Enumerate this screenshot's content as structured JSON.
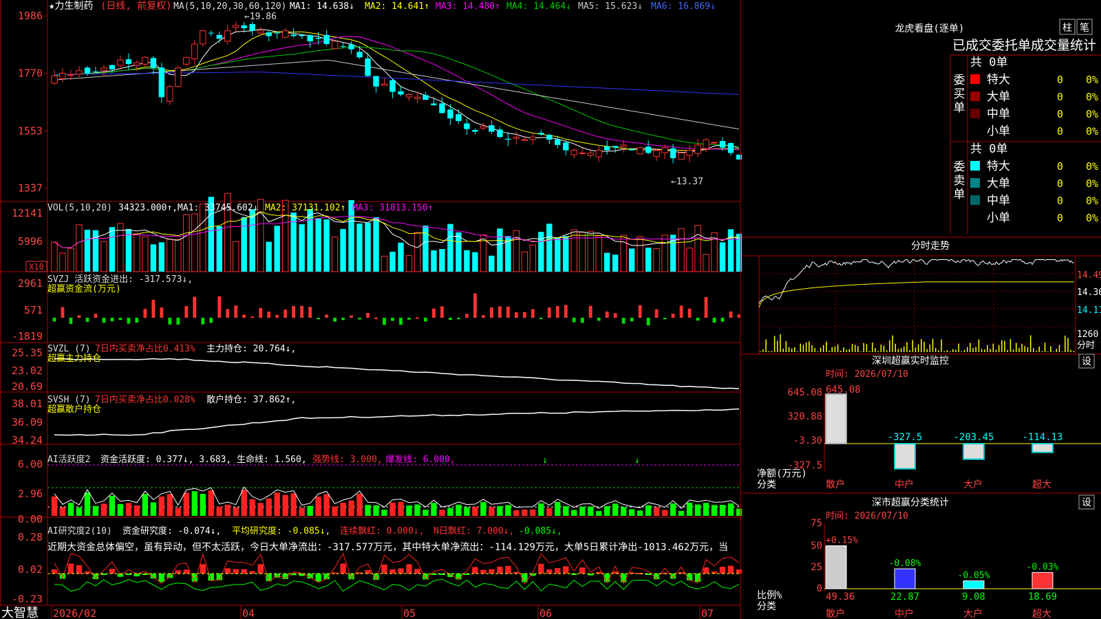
{
  "app": {
    "brand": "大智慧"
  },
  "colors": {
    "up": "#ff3333",
    "down": "#00ffff",
    "buy": "#ff0000",
    "sell": "#00ffff",
    "ma1": "#ffffff",
    "ma2": "#ffff00",
    "ma3": "#ff00ff",
    "ma4": "#00cc00",
    "ma5": "#c8c8c8",
    "ma6": "#3333ff",
    "frame": "#b00000"
  },
  "header": {
    "title": "★力生制药",
    "mode": "(日线, 前复权)",
    "ma_label": "MA(5,10,20,30,60,120)",
    "ma": [
      {
        "name": "MA1",
        "value": "14.638",
        "arrow": "↓"
      },
      {
        "name": "MA2",
        "value": "14.641",
        "arrow": "↑"
      },
      {
        "name": "MA3",
        "value": "14.480",
        "arrow": "↑"
      },
      {
        "name": "MA4",
        "value": "14.464",
        "arrow": "↓"
      },
      {
        "name": "MA5",
        "value": "15.623",
        "arrow": "↓"
      },
      {
        "name": "MA6",
        "value": "16.869",
        "arrow": "↓"
      }
    ]
  },
  "panels": {
    "price": {
      "ticks": [
        "1986",
        "1770",
        "1553",
        "1337"
      ],
      "high_label": "19.86",
      "low_label": "←13.37"
    },
    "vol": {
      "label": "VOL(5,10,20)",
      "value": "34323.000",
      "ma": [
        {
          "name": "MA1",
          "value": "33745.602",
          "arrow": "↓"
        },
        {
          "name": "MA2",
          "value": "37131.102",
          "arrow": "↑"
        },
        {
          "name": "MA3",
          "value": "31813.150",
          "arrow": "↑"
        }
      ],
      "ticks": [
        "12141",
        "5996"
      ],
      "unit": "X10"
    },
    "svzj": {
      "label": "SVZJ  活跃资金进出: -317.573↓,",
      "sub": "超赢资金流(万元)",
      "ticks": [
        "2961",
        "571",
        "-1819"
      ]
    },
    "svzl": {
      "label": "SVZL (7)",
      "l2": "7日内买卖净占比0.413%",
      "l3": "主力持仓: 20.764↓,",
      "sub": "超赢主力持仓",
      "ticks": [
        "25.35",
        "23.02",
        "20.69"
      ]
    },
    "svsh": {
      "label": "SVSH (7)",
      "l2": "7日内买卖净占比0.028%",
      "l3": "散户持仓: 37.862↑,",
      "sub": "超赢散户持仓",
      "ticks": [
        "38.01",
        "36.09",
        "34.24"
      ]
    },
    "ai1": {
      "label": "AI活跃度2",
      "l2": "资金活跃度: 0.377↓, 3.683, 生命线: 1.560,",
      "l3": "强势线: 3.000,",
      "l4": "爆发线: 6.000,",
      "ticks": [
        "6.00",
        "2.96",
        "0.00"
      ]
    },
    "ai2": {
      "label": "AI研究度2(10)",
      "l2": "资金研究度: -0.074↓,",
      "l3": "平均研究度: -0.085↓,",
      "l4": "连续飘红: 0.000↓,",
      "l5": "N日飘红: 7.000↓,",
      "l6": "-0.085↓,",
      "text": "近期大资金总体偏空，虽有异动，但不太活跃，今日大单净流出：-317.577万元，其中特大单净流出：-114.129万元，大单5日累计净出-1013.462万元，当",
      "ticks": [
        "0.28",
        "0.02",
        "-0.23"
      ]
    }
  },
  "xaxis": [
    "2026/02",
    "04",
    "05",
    "06",
    "07"
  ],
  "right": {
    "lhb": {
      "title": "龙虎看盘(逐单)",
      "btn1": "柱",
      "btn2": "笔",
      "subtitle": "已成交委托单成交量统计",
      "buy": {
        "side": "委买单",
        "total": "共 0单",
        "rows": [
          {
            "label": "特大",
            "n": "0",
            "pct": "0%",
            "color": "#ff0000"
          },
          {
            "label": "大单",
            "n": "0",
            "pct": "0%",
            "color": "#990000"
          },
          {
            "label": "中单",
            "n": "0",
            "pct": "0%",
            "color": "#660000"
          },
          {
            "label": "小单",
            "n": "0",
            "pct": "0%",
            "color": "#000000"
          }
        ]
      },
      "sell": {
        "side": "委卖单",
        "total": "共 0单",
        "rows": [
          {
            "label": "特大",
            "n": "0",
            "pct": "0%",
            "color": "#00ffff"
          },
          {
            "label": "大单",
            "n": "0",
            "pct": "0%",
            "color": "#008888"
          },
          {
            "label": "中单",
            "n": "0",
            "pct": "0%",
            "color": "#006666"
          },
          {
            "label": "小单",
            "n": "0",
            "pct": "0%",
            "color": "#000000"
          }
        ]
      }
    },
    "fs": {
      "title": "分时走势",
      "ticks": [
        "14.49",
        "14.30",
        "14.11"
      ],
      "vol_tick": "1260",
      "unit": "分时"
    },
    "sz": {
      "title": "深圳超赢实时监控",
      "btn": "设",
      "time": "时间: 2026/07/10",
      "ticks": [
        "645.08",
        "320.88",
        "-3.30",
        "-327.5"
      ],
      "ylabel": "净额(万元)",
      "xlabel": "分类"
    },
    "ss": {
      "title": "深市超赢分类统计",
      "btn": "设",
      "time": "时间: 2026/07/10",
      "ticks": [
        "75",
        "50",
        "25",
        "0"
      ],
      "ylabel": "比例%",
      "xlabel": "分类"
    }
  },
  "chart_data": [
    {
      "type": "candlestick",
      "title": "力生制药 日线 前复权",
      "yrange": [
        13.37,
        19.86
      ],
      "closes_approx": [
        17.6,
        17.7,
        17.65,
        17.8,
        17.7,
        17.75,
        17.9,
        17.85,
        18.2,
        18.05,
        18.1,
        18.3,
        17.9,
        16.8,
        17.2,
        17.9,
        18.3,
        18.8,
        19.3,
        19.2,
        19.0,
        19.3,
        19.5,
        19.4,
        19.3,
        19.3,
        19.1,
        19.2,
        19.3,
        19.1,
        19.1,
        18.9,
        19.0,
        18.8,
        18.9,
        18.7,
        18.6,
        18.3,
        17.6,
        17.2,
        17.3,
        17.0,
        16.9,
        16.9,
        16.8,
        16.7,
        16.5,
        16.2,
        16.0,
        15.9,
        15.6,
        15.5,
        15.7,
        15.5,
        15.3,
        15.2,
        15.3,
        15.2,
        15.3,
        15.4,
        15.2,
        15.0,
        14.8,
        14.8,
        14.7,
        14.7,
        14.8,
        14.8,
        14.9,
        15.0,
        14.8,
        14.9,
        14.7,
        14.8,
        14.9,
        14.5,
        14.7,
        14.8,
        15.0,
        15.2,
        15.1,
        14.9,
        14.7,
        14.45
      ]
    },
    {
      "type": "bar",
      "title": "深圳超赢实时监控",
      "categories": [
        "散户",
        "中户",
        "大户",
        "超大"
      ],
      "values": [
        645.08,
        -327.5,
        -203.45,
        -114.13
      ],
      "ylabel": "净额(万元)",
      "xlabel": "分类",
      "yticks": [
        645.08,
        320.88,
        -3.3,
        -327.5
      ]
    },
    {
      "type": "bar",
      "title": "深市超赢分类统计",
      "categories": [
        "散户",
        "中户",
        "大户",
        "超大"
      ],
      "values": [
        49.36,
        22.87,
        9.08,
        18.69
      ],
      "changes": [
        "+0.15%",
        "-0.08%",
        "-0.05%",
        "-0.03%"
      ],
      "ylabel": "比例%",
      "xlabel": "分类",
      "ylim": [
        0,
        75
      ]
    }
  ]
}
